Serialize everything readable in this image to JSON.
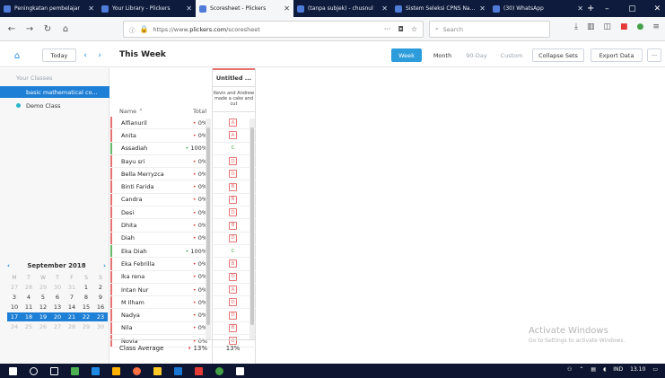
{
  "browser": {
    "tabs": [
      {
        "title": "Peningkatan pembelajar",
        "active": false
      },
      {
        "title": "Your Library - Plickers",
        "active": false
      },
      {
        "title": "Scoresheet - Plickers",
        "active": true
      },
      {
        "title": "(tanpa subjek) - chusnul",
        "active": false
      },
      {
        "title": "Sistem Seleksi CPNS Nasion",
        "active": false
      },
      {
        "title": "(30) WhatsApp",
        "active": false
      }
    ],
    "url_prefix": "https://www.",
    "url_host": "plickers.com",
    "url_path": "/scoresheet",
    "search_placeholder": "Search"
  },
  "app": {
    "today_label": "Today",
    "page_title": "This Week",
    "view_buttons": {
      "week": "Week",
      "month": "Month",
      "ninety": "90-Day",
      "custom": "Custom"
    },
    "collapse_sets": "Collapse Sets",
    "export_data": "Export Data",
    "more": "···"
  },
  "sidebar": {
    "label": "Your Classes",
    "classes": [
      {
        "name": "basic mathematical co...",
        "active": true
      },
      {
        "name": "Demo Class",
        "active": false
      }
    ]
  },
  "calendar": {
    "month": "September 2018",
    "dow": [
      "M",
      "T",
      "W",
      "T",
      "F",
      "S",
      "S"
    ],
    "weeks": [
      [
        "27",
        "28",
        "29",
        "30",
        "31",
        "1",
        "2"
      ],
      [
        "3",
        "4",
        "5",
        "6",
        "7",
        "8",
        "9"
      ],
      [
        "10",
        "11",
        "12",
        "13",
        "14",
        "15",
        "16"
      ],
      [
        "17",
        "18",
        "19",
        "20",
        "21",
        "22",
        "23"
      ],
      [
        "24",
        "25",
        "26",
        "27",
        "28",
        "29",
        "30"
      ]
    ]
  },
  "scoresheet": {
    "name_header": "Name",
    "total_header": "Total",
    "question_title": "Untitled ...",
    "question_desc": "Kevin and Andrew made a cake and cut",
    "students": [
      {
        "name": "Alfianuril",
        "total": "0%",
        "answer": "A",
        "correct": false
      },
      {
        "name": "Anita",
        "total": "0%",
        "answer": "A",
        "correct": false
      },
      {
        "name": "Assadiah",
        "total": "100%",
        "answer": "C",
        "correct": true
      },
      {
        "name": "Bayu sri",
        "total": "0%",
        "answer": "D",
        "correct": false
      },
      {
        "name": "Bella Merryzca",
        "total": "0%",
        "answer": "D",
        "correct": false
      },
      {
        "name": "Binti Farida",
        "total": "0%",
        "answer": "B",
        "correct": false
      },
      {
        "name": "Candra",
        "total": "0%",
        "answer": "B",
        "correct": false
      },
      {
        "name": "Desi",
        "total": "0%",
        "answer": "D",
        "correct": false
      },
      {
        "name": "Dhita",
        "total": "0%",
        "answer": "B",
        "correct": false
      },
      {
        "name": "Diah",
        "total": "0%",
        "answer": "D",
        "correct": false
      },
      {
        "name": "Eka Diah",
        "total": "100%",
        "answer": "C",
        "correct": true
      },
      {
        "name": "Eka Febrilla",
        "total": "0%",
        "answer": "B",
        "correct": false
      },
      {
        "name": "Ika rena",
        "total": "0%",
        "answer": "D",
        "correct": false
      },
      {
        "name": "Intan Nur",
        "total": "0%",
        "answer": "A",
        "correct": false
      },
      {
        "name": "M Ilham",
        "total": "0%",
        "answer": "D",
        "correct": false
      },
      {
        "name": "Nadya",
        "total": "0%",
        "answer": "D",
        "correct": false
      },
      {
        "name": "Nila",
        "total": "0%",
        "answer": "B",
        "correct": false
      },
      {
        "name": "Novia",
        "total": "0%",
        "answer": "D",
        "correct": false
      }
    ],
    "average_label": "Class Average",
    "average_total": "13%",
    "average_question": "13%"
  },
  "watermark": {
    "line1": "Activate Windows",
    "line2": "Go to Settings to activate Windows."
  },
  "taskbar": {
    "time": "13.10",
    "lang": "IND"
  }
}
